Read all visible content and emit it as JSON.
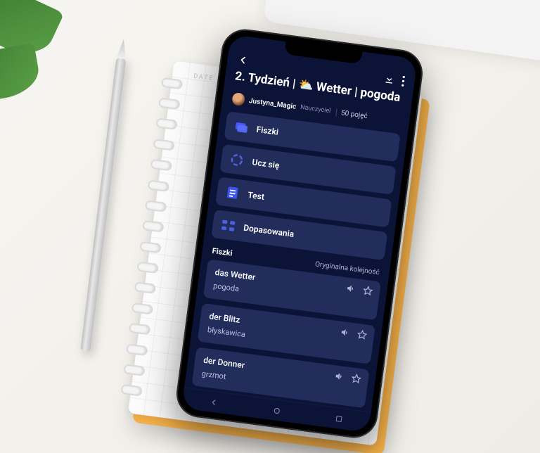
{
  "header": {
    "title": "2. Tydzień | ⛅ Wetter | pogoda"
  },
  "author": {
    "name": "Justyna_Magic",
    "role": "Nauczyciel",
    "term_count": "50 pojęć"
  },
  "modes": [
    {
      "label": "Fiszki"
    },
    {
      "label": "Ucz się"
    },
    {
      "label": "Test"
    },
    {
      "label": "Dopasowania"
    }
  ],
  "section": {
    "left": "Fiszki",
    "right": "Oryginalna kolejność"
  },
  "cards": [
    {
      "term": "das Wetter",
      "definition": "pogoda"
    },
    {
      "term": "der Blitz",
      "definition": "błyskawica"
    },
    {
      "term": "der Donner",
      "definition": "grzmot"
    }
  ]
}
